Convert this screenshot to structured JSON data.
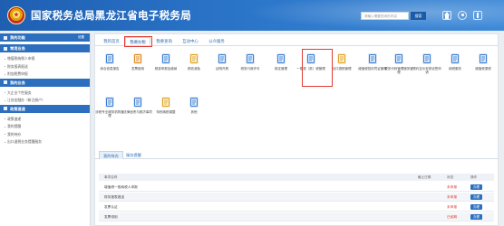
{
  "header": {
    "title": "国家税务总局黑龙江省电子税务局",
    "search_placeholder": "请输入需要查询的内容",
    "search_button": "搜索"
  },
  "sidebar": {
    "sections": [
      {
        "title": "我的功能",
        "extra": "设置",
        "items": []
      },
      {
        "title": "常用业务",
        "items": [
          "增值税纳税人申报",
          "财务报表报送",
          "附加税费申报"
        ]
      },
      {
        "title": "我的业务",
        "items": [
          "大企业个性服务",
          "江苏金融办（新注册户）"
        ]
      },
      {
        "title": "政策速递",
        "items": [
          "政策速递",
          "我的提醒",
          "我的待办",
          "出口退税业务提醒服务"
        ]
      }
    ]
  },
  "tabs": [
    "我的首页",
    "我要办税",
    "我要查询",
    "互动中心",
    "公众服务"
  ],
  "active_tab": "我要办税",
  "grid_items": [
    {
      "label": "综合信息报告",
      "icon": "document-icon",
      "color": "#3b7fd0"
    },
    {
      "label": "发票使用",
      "icon": "invoice-icon",
      "color": "#e08a1d"
    },
    {
      "label": "税费申报及缴纳",
      "icon": "tax-report-icon",
      "color": "#3b7fd0"
    },
    {
      "label": "税收减免",
      "icon": "money-bag-icon",
      "color": "#e0a21d"
    },
    {
      "label": "证明开具",
      "icon": "certificate-icon",
      "color": "#3b7fd0"
    },
    {
      "label": "税务行政许可",
      "icon": "license-icon",
      "color": "#3b7fd0"
    },
    {
      "label": "核定管理",
      "icon": "approval-icon",
      "color": "#3b7fd0"
    },
    {
      "label": "一般退（抵）税管理",
      "icon": "refund-icon",
      "color": "#3b7fd0"
    },
    {
      "label": "出口退税管理",
      "icon": "globe-icon",
      "color": "#e0a21d"
    },
    {
      "label": "增值税抵扣凭证管理",
      "icon": "voucher-icon",
      "color": "#3b7fd0"
    },
    {
      "label": "税务代码管理服务管理",
      "icon": "code-icon",
      "color": "#3b7fd0"
    },
    {
      "label": "预约定价安排谈签申请",
      "icon": "agreement-icon",
      "color": "#3b7fd0"
    },
    {
      "label": "纳税服务",
      "icon": "service-icon",
      "color": "#3b7fd0"
    },
    {
      "label": "增值税退税",
      "icon": "house-icon",
      "color": "#3b7fd0"
    },
    {
      "label": "涉税专业服务机构管理",
      "icon": "building-icon",
      "color": "#3b7fd0"
    },
    {
      "label": "法律追责与救济事项",
      "icon": "law-icon",
      "color": "#3b7fd0"
    },
    {
      "label": "特别纳税调整",
      "icon": "adjust-icon",
      "color": "#e0a21d"
    },
    {
      "label": "其他",
      "icon": "other-icon",
      "color": "#3b7fd0"
    }
  ],
  "todo": {
    "tabs": [
      "我的待办",
      "服务提醒"
    ],
    "columns": [
      "事项名称",
      "截止日期",
      "状态",
      "操作"
    ],
    "rows": [
      {
        "name": "增值税一般纳税人申报",
        "status": "未申报",
        "action": "办理"
      },
      {
        "name": "财务报表报送",
        "status": "未申报",
        "action": "办理"
      },
      {
        "name": "发票认证",
        "status": "未申报",
        "action": "办理"
      },
      {
        "name": "发票领用",
        "status": "已逾期",
        "action": "办理"
      }
    ]
  },
  "colors": {
    "header_blue": "#2a74c8",
    "highlight_red": "#e23b33",
    "button_blue": "#2d6fbf"
  }
}
